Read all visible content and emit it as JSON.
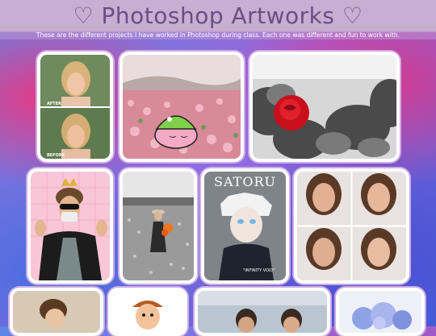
{
  "header": {
    "title": "♡ Photoshop Artworks ♡",
    "subtitle": "These are the different projects I have worked in Photoshop during class. Each one was different and fun to work with."
  },
  "gallery": {
    "artworks": [
      {
        "name": "before-after-portrait",
        "captions": [
          "AFTER",
          "BEFORE"
        ]
      },
      {
        "name": "flower-field-kirby"
      },
      {
        "name": "red-rose"
      },
      {
        "name": "sticker-portrait"
      },
      {
        "name": "flower-field-girl"
      },
      {
        "name": "satoru-poster",
        "poster_title": "SATORU",
        "poster_caption": "\"INFINITY VOID\""
      },
      {
        "name": "face-retouch-grid"
      },
      {
        "name": "cartoon-portrait"
      },
      {
        "name": "cartoon-boy"
      },
      {
        "name": "two-friends"
      },
      {
        "name": "blue-flowers"
      }
    ]
  },
  "colors": {
    "header_bg": "#c8aed1",
    "title_color": "#6b4d86",
    "card_border": "#d6b4e6"
  }
}
